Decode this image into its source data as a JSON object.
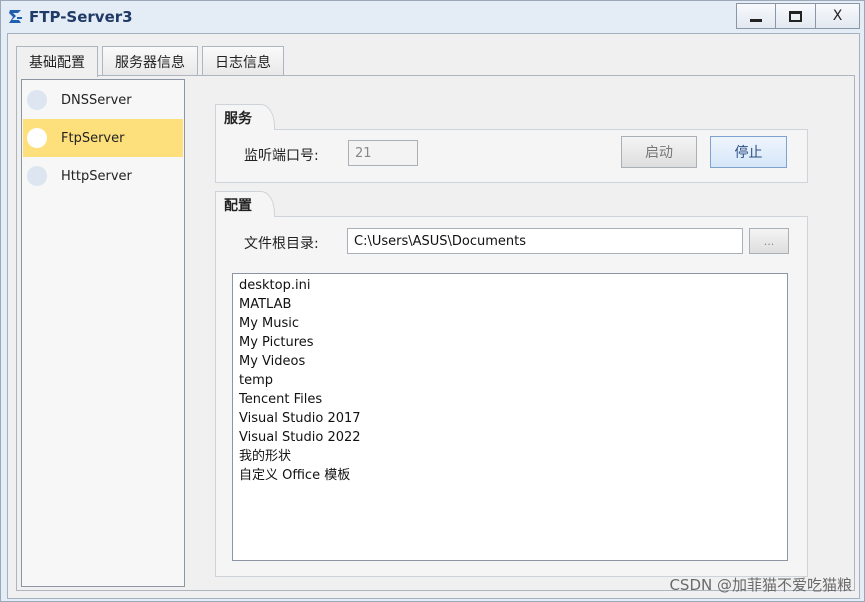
{
  "window": {
    "title": "FTP-Server3",
    "minimize_icon": "minimize-icon",
    "maximize_icon": "maximize-icon",
    "close_label": "X"
  },
  "tabs": [
    {
      "label": "基础配置",
      "active": true
    },
    {
      "label": "服务器信息",
      "active": false
    },
    {
      "label": "日志信息",
      "active": false
    }
  ],
  "servers": [
    {
      "label": "DNSServer",
      "selected": false
    },
    {
      "label": "FtpServer",
      "selected": true
    },
    {
      "label": "HttpServer",
      "selected": false
    }
  ],
  "service": {
    "group_title": "服务",
    "port_label": "监听端口号:",
    "port_value": "21",
    "start_label": "启动",
    "stop_label": "停止"
  },
  "config": {
    "group_title": "配置",
    "root_label": "文件根目录:",
    "root_value": "C:\\Users\\ASUS\\Documents",
    "browse_label": "...",
    "files": [
      "desktop.ini",
      "MATLAB",
      "My Music",
      "My Pictures",
      "My Videos",
      "temp",
      "Tencent Files",
      "Visual Studio 2017",
      "Visual Studio 2022",
      "我的形状",
      "自定义 Office 模板"
    ]
  },
  "watermark": "CSDN @加菲猫不爱吃猫粮",
  "colors": {
    "selected_item": "#fde07c",
    "titlebar": "#e4ecf6",
    "primary_button": "#d6e6f8"
  }
}
